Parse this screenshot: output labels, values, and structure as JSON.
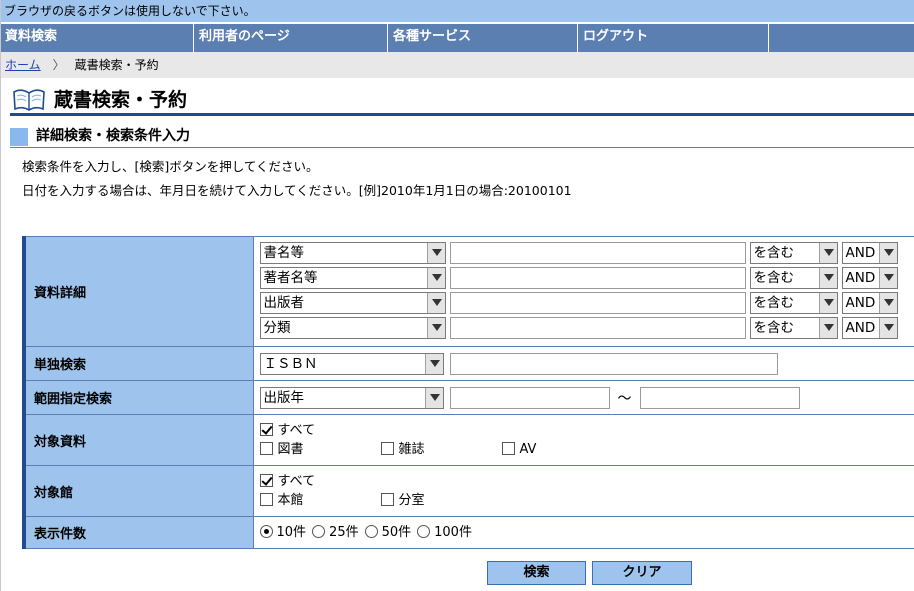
{
  "notice": "ブラウザの戻るボタンは使用しないで下さい。",
  "nav": [
    {
      "label": "資料検索"
    },
    {
      "label": "利用者のページ"
    },
    {
      "label": "各種サービス"
    },
    {
      "label": "ログアウト"
    }
  ],
  "breadcrumb": {
    "home": "ホーム",
    "sep": "〉",
    "current": "蔵書検索・予約"
  },
  "page_title": "蔵書検索・予約",
  "section_title": "詳細検索・検索条件入力",
  "description": [
    "検索条件を入力し、[検索]ボタンを押してください。",
    "日付を入力する場合は、年月日を続けて入力してください。[例]2010年1月1日の場合:20100101"
  ],
  "form": {
    "detail": {
      "label": "資料詳細",
      "rows": [
        {
          "field": "書名等",
          "match": "を含む",
          "op": "AND",
          "value": ""
        },
        {
          "field": "著者名等",
          "match": "を含む",
          "op": "AND",
          "value": ""
        },
        {
          "field": "出版者",
          "match": "を含む",
          "op": "AND",
          "value": ""
        },
        {
          "field": "分類",
          "match": "を含む",
          "op": "AND",
          "value": ""
        }
      ]
    },
    "single": {
      "label": "単独検索",
      "field": "ＩＳＢＮ",
      "value": ""
    },
    "range": {
      "label": "範囲指定検索",
      "field": "出版年",
      "tilde": "～",
      "from": "",
      "to": ""
    },
    "material": {
      "label": "対象資料",
      "all": "すべて",
      "options": [
        "図書",
        "雑誌",
        "AV"
      ]
    },
    "library": {
      "label": "対象館",
      "all": "すべて",
      "options": [
        "本館",
        "分室"
      ]
    },
    "count": {
      "label": "表示件数",
      "options": [
        "10件",
        "25件",
        "50件",
        "100件"
      ],
      "selected": "10件"
    }
  },
  "buttons": {
    "search": "検索",
    "clear": "クリア"
  },
  "colors": {
    "nav_bg": "#5c7fb1",
    "notice_bg": "#9ec3ec",
    "label_bg": "#9ec3ec",
    "accent": "#1e4c8f"
  }
}
